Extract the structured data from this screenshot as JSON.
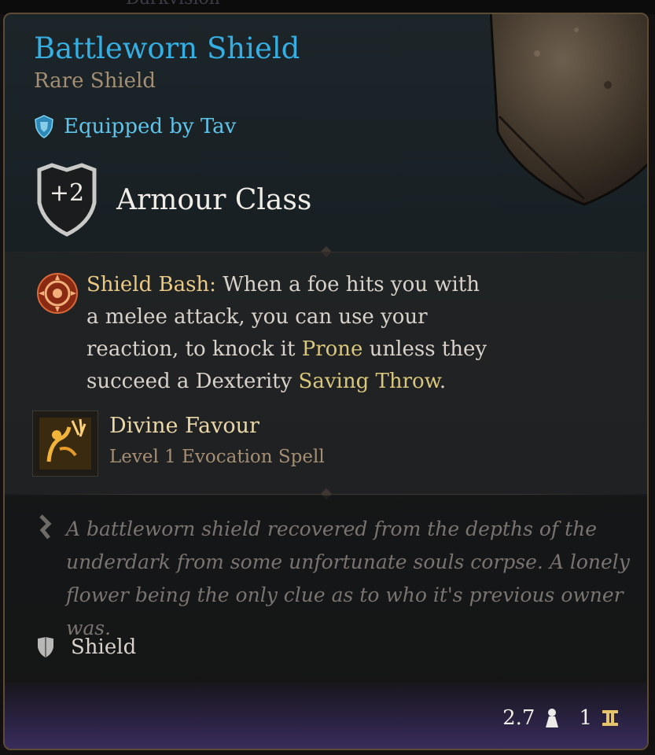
{
  "background_label": "Darkvision",
  "item": {
    "name": "Battleworn Shield",
    "rarity_type": "Rare Shield",
    "equipped_by": "Equipped by Tav",
    "armour_class": {
      "bonus": "+2",
      "label": "Armour Class"
    },
    "passive": {
      "name": "Shield Bash:",
      "text_1": " When a foe hits you with a melee attack, you can use your reaction, to knock it ",
      "keyword_1": "Prone",
      "text_2": " unless they succeed a Dexterity ",
      "keyword_2": "Saving Throw",
      "text_3": "."
    },
    "spell": {
      "name": "Divine Favour",
      "detail": "Level 1 Evocation Spell"
    },
    "flavor_text": "A battleworn shield recovered from the depths of the underdark from some unfortunate souls corpse. A lonely flower being the only clue as to who it's previous owner was.",
    "type_label": "Shield",
    "weight": "2.7",
    "value": "1"
  },
  "icons": {
    "equipped": "equipped-armor-icon",
    "ac": "ac-shield-badge-icon",
    "passive": "shield-bash-icon",
    "spell": "divine-favour-icon",
    "flavor": "scroll-quill-icon",
    "type": "shield-type-icon",
    "weight": "weight-icon",
    "value": "gold-value-icon"
  },
  "colors": {
    "title": "#35aee2",
    "rarity": "#a58f74",
    "equipped": "#5fc3ea",
    "keyword": "#d9c77c",
    "passive_name": "#e9c984",
    "border": "#5c4c36"
  }
}
